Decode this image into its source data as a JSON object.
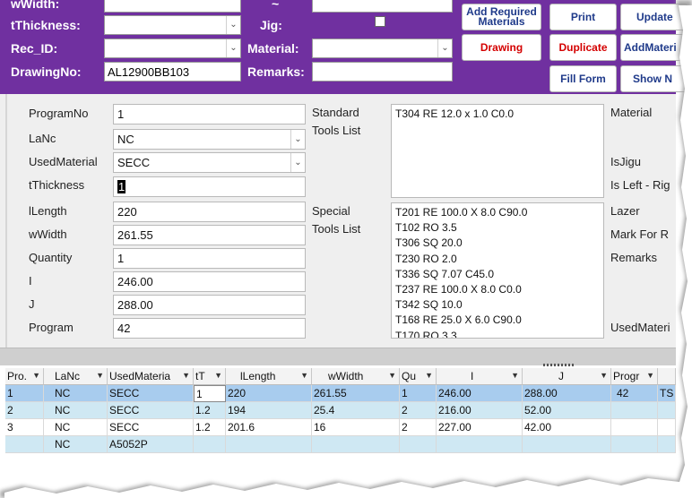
{
  "header": {
    "labels": {
      "wwidth": "wWidth:",
      "tthickness": "tThickness:",
      "rec_id": "Rec_ID:",
      "drawingno": "DrawingNo:",
      "tilde": "~",
      "jig": "Jig:",
      "material": "Material:",
      "remarks": "Remarks:"
    },
    "drawingno_value": "AL12900BB103",
    "buttons": {
      "add_required_materials": "Add Required Materials",
      "print": "Print",
      "update": "Update",
      "drawing": "Drawing",
      "duplicate": "Duplicate",
      "add_material": "AddMateri",
      "fill_form": "Fill Form",
      "show": "Show N"
    }
  },
  "form": {
    "labels": {
      "program_no": "ProgramNo",
      "lanc": "LaNc",
      "used_material": "UsedMaterial",
      "tthickness": "tThickness",
      "llength": "lLength",
      "wwidth": "wWidth",
      "quantity": "Quantity",
      "i": "I",
      "j": "J",
      "program": "Program",
      "standard_tools_1": "Standard",
      "standard_tools_2": "Tools List",
      "special_tools_1": "Special",
      "special_tools_2": "Tools List",
      "material": "Material",
      "isjigu": "IsJigu",
      "is_left_right": "Is Left - Rig",
      "lazer": "Lazer",
      "mark_for_r": "Mark For R",
      "remarks": "Remarks",
      "used_materi": "UsedMateri"
    },
    "values": {
      "program_no": "1",
      "lanc": "NC",
      "used_material": "SECC",
      "tthickness": "1",
      "llength": "220",
      "wwidth": "261.55",
      "quantity": "1",
      "i": "246.00",
      "j": "288.00",
      "program": "42"
    },
    "standard_tools": [
      "T304 RE 12.0 x 1.0 C0.0"
    ],
    "special_tools": [
      "T201 RE 100.0 X 8.0 C90.0",
      "T102 RO 3.5",
      "T306 SQ 20.0",
      "T230 RO 2.0",
      "T336 SQ 7.07 C45.0",
      "T237 RE 100.0 X 8.0 C0.0",
      "T342 SQ 10.0",
      "T168 RE 25.0 X 6.0 C90.0",
      "T170 RO 3.3"
    ]
  },
  "grid": {
    "headers": [
      "Pro.",
      "LaNc",
      "UsedMateria",
      "tT",
      "lLength",
      "wWidth",
      "Qu",
      "I",
      "J",
      "Progr",
      ""
    ],
    "rows": [
      [
        "1",
        "NC",
        "SECC",
        "1",
        "220",
        "261.55",
        "1",
        "246.00",
        "288.00",
        "42",
        "TS"
      ],
      [
        "2",
        "NC",
        "SECC",
        "1.2",
        "194",
        "25.4",
        "2",
        "216.00",
        "52.00",
        "",
        ""
      ],
      [
        "3",
        "NC",
        "SECC",
        "1.2",
        "201.6",
        "16",
        "2",
        "227.00",
        "42.00",
        "",
        ""
      ],
      [
        "",
        "NC",
        "A5052P",
        "",
        "",
        "",
        "",
        "",
        "",
        "",
        ""
      ]
    ]
  },
  "colors": {
    "header_bg": "#7030a0",
    "button_text": "#1f3a8a",
    "button_red": "#d40000",
    "row_selected": "#a8ccee",
    "row_alt": "#cfe8f3"
  }
}
